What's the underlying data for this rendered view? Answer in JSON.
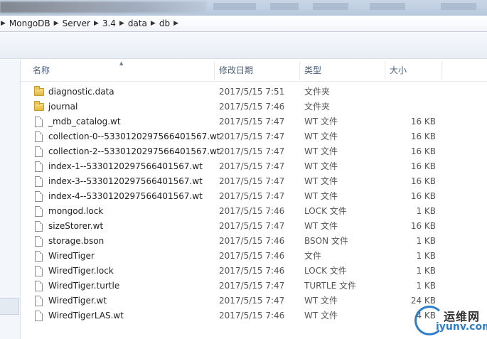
{
  "breadcrumb": [
    "MongoDB",
    "Server",
    "3.4",
    "data",
    "db"
  ],
  "columns": {
    "name": "名称",
    "date": "修改日期",
    "type": "类型",
    "size": "大小"
  },
  "files": [
    {
      "name": "diagnostic.data",
      "date": "2017/5/15 7:51",
      "type": "文件夹",
      "size": "",
      "icon": "folder-icon"
    },
    {
      "name": "journal",
      "date": "2017/5/15 7:46",
      "type": "文件夹",
      "size": "",
      "icon": "folder-icon"
    },
    {
      "name": "_mdb_catalog.wt",
      "date": "2017/5/15 7:47",
      "type": "WT 文件",
      "size": "16 KB",
      "icon": "file-icon"
    },
    {
      "name": "collection-0--5330120297566401567.wt",
      "date": "2017/5/15 7:47",
      "type": "WT 文件",
      "size": "16 KB",
      "icon": "file-icon"
    },
    {
      "name": "collection-2--5330120297566401567.wt",
      "date": "2017/5/15 7:47",
      "type": "WT 文件",
      "size": "16 KB",
      "icon": "file-icon"
    },
    {
      "name": "index-1--5330120297566401567.wt",
      "date": "2017/5/15 7:47",
      "type": "WT 文件",
      "size": "16 KB",
      "icon": "file-icon"
    },
    {
      "name": "index-3--5330120297566401567.wt",
      "date": "2017/5/15 7:47",
      "type": "WT 文件",
      "size": "16 KB",
      "icon": "file-icon"
    },
    {
      "name": "index-4--5330120297566401567.wt",
      "date": "2017/5/15 7:47",
      "type": "WT 文件",
      "size": "16 KB",
      "icon": "file-icon"
    },
    {
      "name": "mongod.lock",
      "date": "2017/5/15 7:46",
      "type": "LOCK 文件",
      "size": "1 KB",
      "icon": "file-icon"
    },
    {
      "name": "sizeStorer.wt",
      "date": "2017/5/15 7:47",
      "type": "WT 文件",
      "size": "16 KB",
      "icon": "file-icon"
    },
    {
      "name": "storage.bson",
      "date": "2017/5/15 7:46",
      "type": "BSON 文件",
      "size": "1 KB",
      "icon": "file-icon"
    },
    {
      "name": "WiredTiger",
      "date": "2017/5/15 7:46",
      "type": "文件",
      "size": "1 KB",
      "icon": "file-icon"
    },
    {
      "name": "WiredTiger.lock",
      "date": "2017/5/15 7:46",
      "type": "LOCK 文件",
      "size": "1 KB",
      "icon": "file-icon"
    },
    {
      "name": "WiredTiger.turtle",
      "date": "2017/5/15 7:47",
      "type": "TURTLE 文件",
      "size": "1 KB",
      "icon": "file-icon"
    },
    {
      "name": "WiredTiger.wt",
      "date": "2017/5/15 7:47",
      "type": "WT 文件",
      "size": "24 KB",
      "icon": "file-icon"
    },
    {
      "name": "WiredTigerLAS.wt",
      "date": "2017/5/15 7:46",
      "type": "WT 文件",
      "size": "4 KB",
      "icon": "file-icon"
    }
  ],
  "watermark": {
    "cn": "运维网",
    "en": "iyunv.com"
  }
}
